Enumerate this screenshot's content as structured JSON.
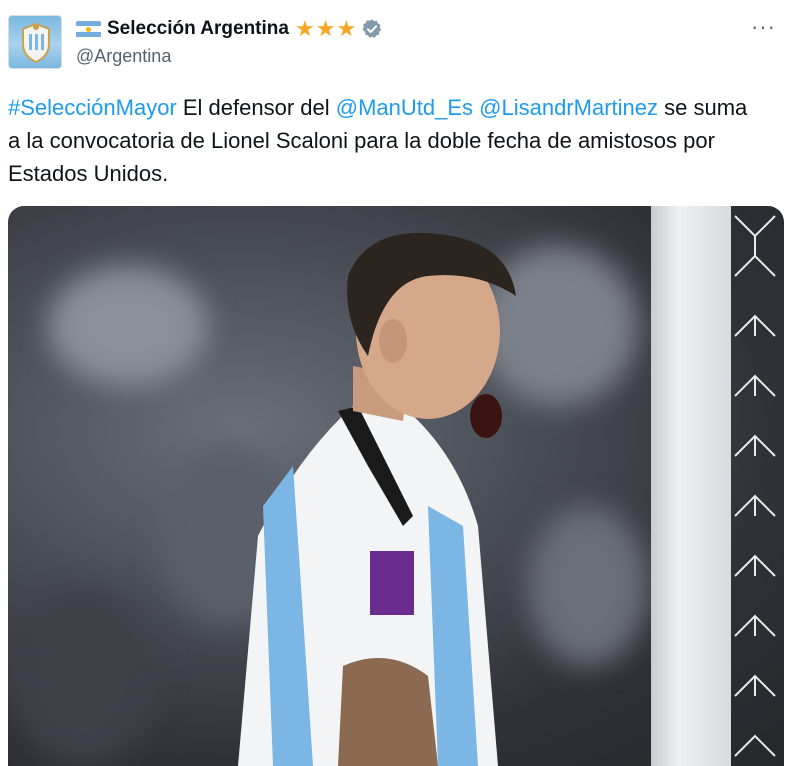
{
  "account": {
    "name": "Selección Argentina",
    "handle": "@Argentina",
    "star_count": 3,
    "icons": {
      "avatar": "afa-crest-icon",
      "flag": "argentina-flag-icon",
      "verified": "verified-badge-icon",
      "more": "more-options-icon"
    }
  },
  "menu": {
    "more_label": "···"
  },
  "tweet": {
    "hashtag": "#SelecciónMayor",
    "part1": " El defensor del ",
    "mention1": "@ManUtd_Es",
    "space": " ",
    "mention2": "@LisandrMartinez",
    "part2": " se suma a la convocatoria de Lionel Scaloni para la doble fecha de amistosos por Estados Unidos."
  },
  "colors": {
    "link": "#1d9bf0",
    "star": "#f5a623",
    "verified": "#829aab",
    "flag_blue": "#74acdf",
    "flag_sun": "#f6b40e"
  },
  "media": {
    "description_icon": "player-photo"
  }
}
